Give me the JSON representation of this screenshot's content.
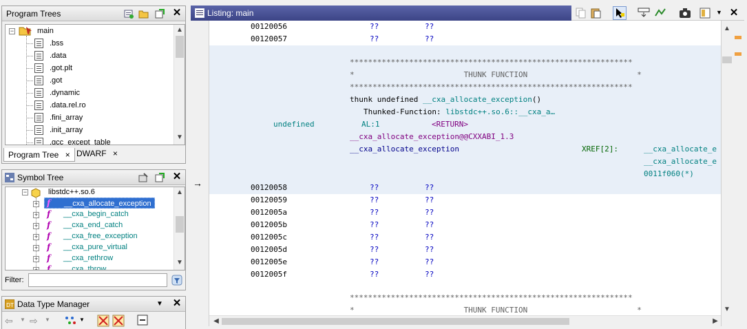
{
  "program_trees": {
    "title": "Program Trees",
    "root": "main",
    "items": [
      ".bss",
      ".data",
      ".got.plt",
      ".got",
      ".dynamic",
      ".data.rel.ro",
      ".fini_array",
      ".init_array",
      ".gcc_except_table"
    ],
    "tabs": [
      {
        "label": "Program Tree"
      },
      {
        "label": "DWARF"
      }
    ],
    "tab_close": "×"
  },
  "symbol_tree": {
    "title": "Symbol Tree",
    "library": "libstdc++.so.6",
    "functions": [
      "__cxa_allocate_exception",
      "__cxa_begin_catch",
      "__cxa_end_catch",
      "__cxa_free_exception",
      "__cxa_pure_virtual",
      "__cxa_rethrow",
      "__cxa_throw"
    ],
    "selected_index": 0,
    "filter_label": "Filter:",
    "filter_value": ""
  },
  "data_type_manager": {
    "title": "Data Type Manager"
  },
  "listing": {
    "title": "Listing:  main",
    "lines_before": [
      {
        "addr": "00120056",
        "b1": "??",
        "b2": "??"
      },
      {
        "addr": "00120057",
        "b1": "??",
        "b2": "??"
      }
    ],
    "stars": "**************************************************************",
    "banner": "*                        THUNK FUNCTION                        *",
    "signature_prefix": "thunk undefined ",
    "signature_name": "__cxa_allocate_exception",
    "signature_suffix": "()",
    "thunked_label": "Thunked-Function: ",
    "thunked_target": "libstdc++.so.6::__cxa_a…",
    "ret_type": "undefined",
    "ret_storage": "AL:1",
    "ret_name": "<RETURN>",
    "label_versioned": "__cxa_allocate_exception@@CXXABI_1.3",
    "label_plain": "__cxa_allocate_exception",
    "xref_label": "XREF[2]:",
    "xref_1": "__cxa_allocate_e",
    "xref_2": "__cxa_allocate_e",
    "xref_3": "0011f060(*)",
    "lines_after": [
      {
        "addr": "00120058",
        "b1": "??",
        "b2": "??"
      },
      {
        "addr": "00120059",
        "b1": "??",
        "b2": "??"
      },
      {
        "addr": "0012005a",
        "b1": "??",
        "b2": "??"
      },
      {
        "addr": "0012005b",
        "b1": "??",
        "b2": "??"
      },
      {
        "addr": "0012005c",
        "b1": "??",
        "b2": "??"
      },
      {
        "addr": "0012005d",
        "b1": "??",
        "b2": "??"
      },
      {
        "addr": "0012005e",
        "b1": "??",
        "b2": "??"
      },
      {
        "addr": "0012005f",
        "b1": "??",
        "b2": "??"
      }
    ],
    "cursor_marker": "→"
  },
  "colors": {
    "listing_header": "#3c4486",
    "selection": "#2f6fd0",
    "function_block": "#e8eff8",
    "teal_label": "#008080"
  }
}
